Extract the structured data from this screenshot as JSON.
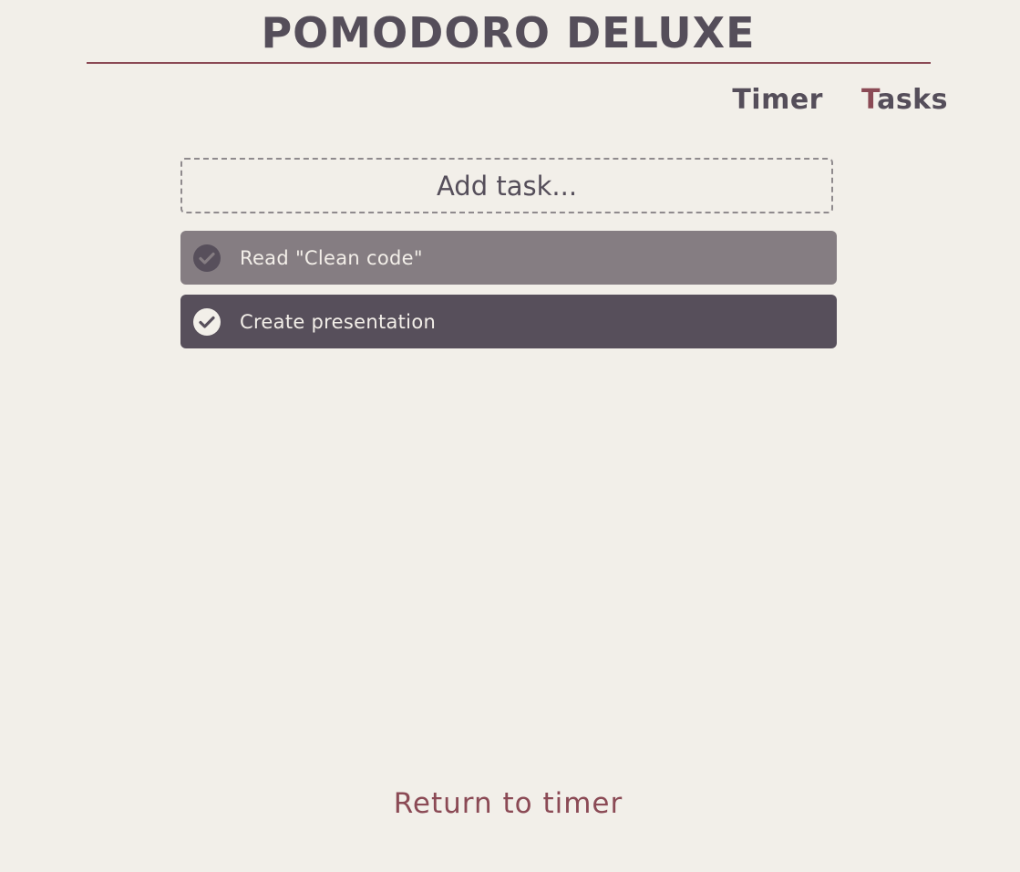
{
  "app": {
    "title": "POMODORO DELUXE"
  },
  "nav": {
    "items": [
      {
        "first": "T",
        "rest": "imer",
        "active": false
      },
      {
        "first": "T",
        "rest": "asks",
        "active": true
      }
    ]
  },
  "add_task": {
    "placeholder": "Add task..."
  },
  "tasks": [
    {
      "label": "Read \"Clean code\"",
      "status": "done",
      "icon": "check-circle-icon"
    },
    {
      "label": "Create presentation",
      "status": "active",
      "icon": "check-circle-icon"
    }
  ],
  "footer": {
    "return_label": "Return to timer"
  },
  "colors": {
    "background": "#f2efe9",
    "text": "#554e5a",
    "accent": "#8b4a55",
    "task_done_bg": "#857d82",
    "task_active_bg": "#574f5b"
  }
}
